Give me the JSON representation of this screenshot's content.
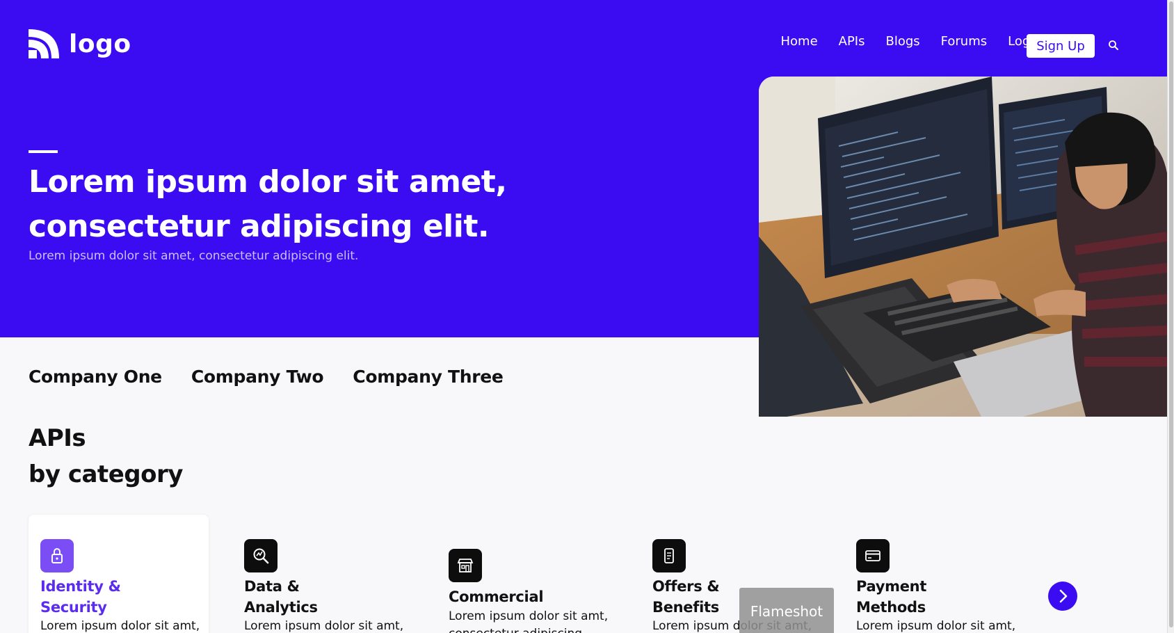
{
  "colors": {
    "brand": "#3b0cf2",
    "accent": "#7b4df5",
    "text": "#111111",
    "background": "#f8f8fa"
  },
  "header": {
    "logo_text": "logo",
    "nav": [
      {
        "label": "Home"
      },
      {
        "label": "APIs"
      },
      {
        "label": "Blogs"
      },
      {
        "label": "Forums"
      },
      {
        "label": "LogIn"
      }
    ],
    "signup_label": "Sign Up",
    "search_icon": "search-icon"
  },
  "hero": {
    "title": "Lorem ipsum dolor sit amet, consectetur adipiscing elit.",
    "subtitle": "Lorem ipsum dolor sit amet, consectetur adipiscing elit."
  },
  "companies": [
    "Company One",
    "Company Two",
    "Company Three"
  ],
  "apis_section": {
    "heading_line1": "APIs",
    "heading_line2": "by category"
  },
  "categories": [
    {
      "title": "Identity &\nSecurity",
      "desc": "Lorem ipsum dolor sit amt,",
      "icon": "lock-icon",
      "active": true
    },
    {
      "title": "Data &\nAnalytics",
      "desc": "Lorem ipsum dolor sit amt,",
      "icon": "analytics-icon",
      "active": false
    },
    {
      "title": "Commercial",
      "desc": "Lorem ipsum dolor sit amt,",
      "desc2": "consectetur adipiscing",
      "icon": "store-icon",
      "active": false
    },
    {
      "title": "Offers &\nBenefits",
      "desc": "Lorem ipsum dolor sit amt,",
      "icon": "coupon-icon",
      "active": false
    },
    {
      "title": "Payment\nMethods",
      "desc": "Lorem ipsum dolor sit amt,",
      "icon": "credit-card-icon",
      "active": false
    }
  ],
  "overlay": {
    "flameshot_label": "Flameshot"
  }
}
